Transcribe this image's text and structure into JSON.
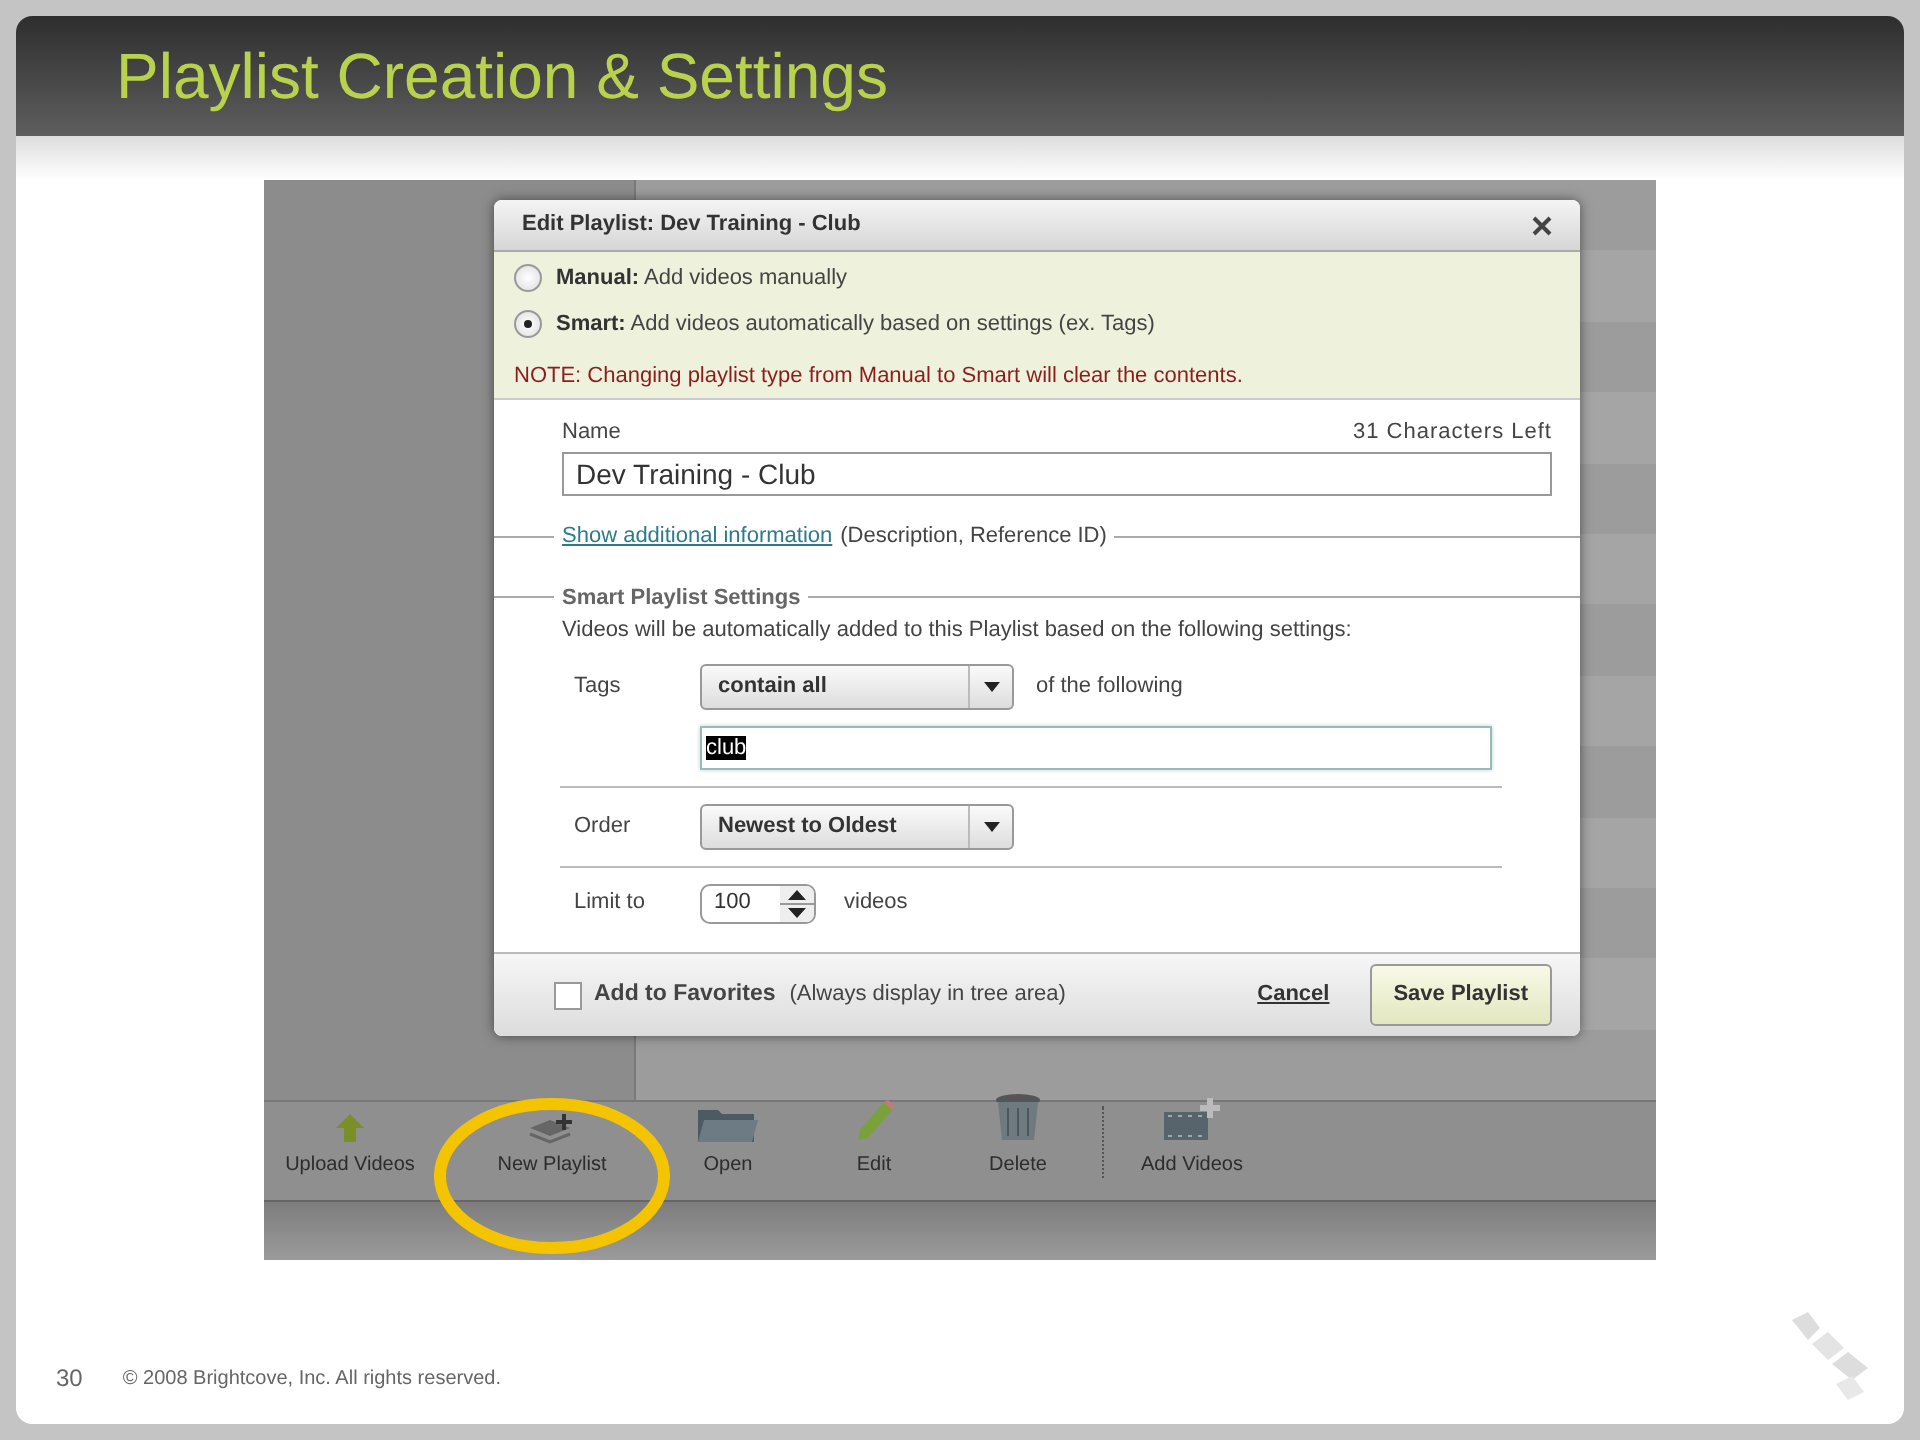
{
  "slide": {
    "title": "Playlist Creation & Settings",
    "page_number": "30",
    "copyright": "© 2008 Brightcove, Inc. All rights reserved."
  },
  "toolbar": [
    {
      "label": "Upload Videos"
    },
    {
      "label": "New Playlist"
    },
    {
      "label": "Open"
    },
    {
      "label": "Edit"
    },
    {
      "label": "Delete"
    },
    {
      "label": "Add Videos"
    }
  ],
  "dialog": {
    "title": "Edit Playlist:  Dev Training - Club",
    "modes": [
      {
        "label": "Manual:",
        "description": "Add videos manually",
        "selected": false
      },
      {
        "label": "Smart:",
        "description": "Add videos automatically based on settings (ex. Tags)",
        "selected": true
      }
    ],
    "note": "NOTE: Changing playlist type from Manual to Smart will clear the contents.",
    "name_label": "Name",
    "chars_left": "31 Characters Left",
    "name_value": "Dev Training - Club",
    "additional_link": "Show additional information",
    "additional_hint": "(Description, Reference ID)",
    "smart_legend": "Smart Playlist Settings",
    "smart_desc": "Videos will be automatically added to this Playlist based on the following settings:",
    "tags_label": "Tags",
    "tags_select": "contain all",
    "tags_suffix": "of the following",
    "tags_value": "club",
    "order_label": "Order",
    "order_select": "Newest to Oldest",
    "limit_label": "Limit to",
    "limit_value": "100",
    "limit_suffix": "videos",
    "favorites": {
      "label": "Add to Favorites",
      "hint": "(Always display in tree area)",
      "checked": false
    },
    "cancel": "Cancel",
    "save": "Save Playlist"
  }
}
